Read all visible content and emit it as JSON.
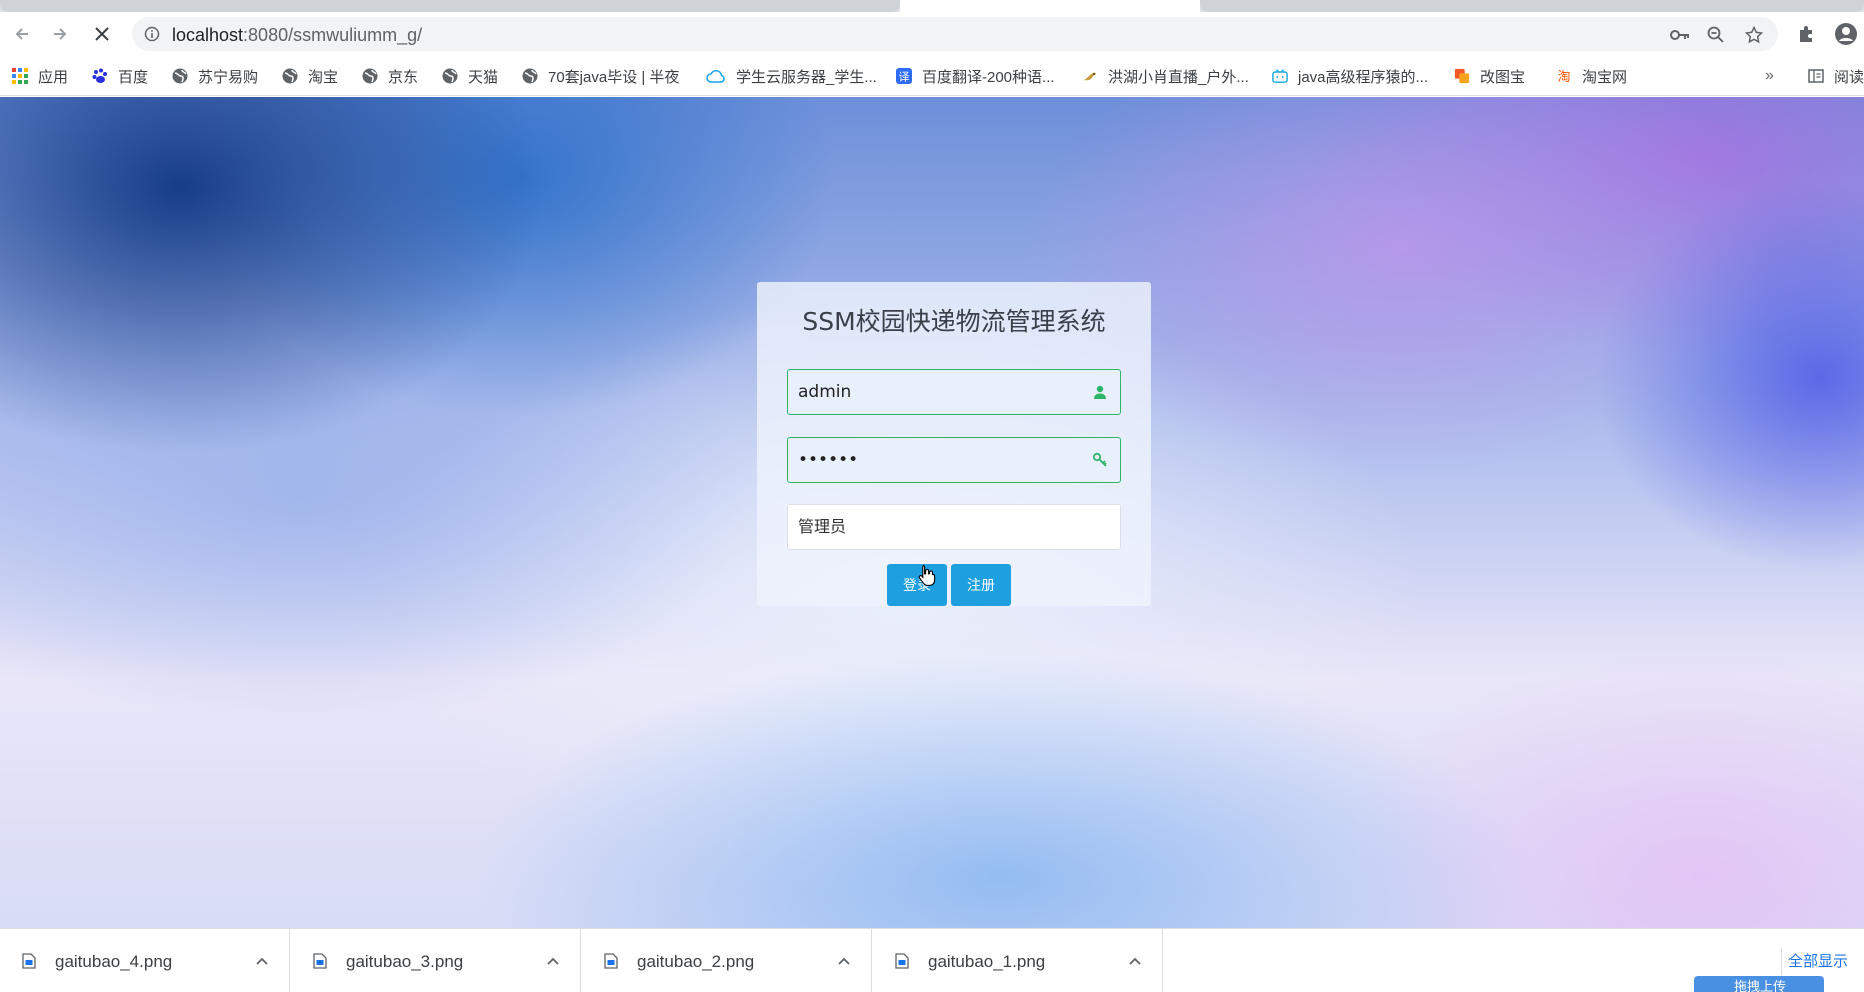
{
  "browser": {
    "url_host": "localhost",
    "url_path": ":8080/ssmwuliumm_g/",
    "bookmarks": [
      {
        "label": "应用",
        "icon": "apps-grid-icon"
      },
      {
        "label": "百度",
        "icon": "baidu-paw-icon"
      },
      {
        "label": "苏宁易购",
        "icon": "globe-icon"
      },
      {
        "label": "淘宝",
        "icon": "globe-icon"
      },
      {
        "label": "京东",
        "icon": "globe-icon"
      },
      {
        "label": "天猫",
        "icon": "globe-icon"
      },
      {
        "label": "70套java毕设 | 半夜",
        "icon": "globe-icon"
      },
      {
        "label": "学生云服务器_学生...",
        "icon": "cloud-icon"
      },
      {
        "label": "百度翻译-200种语...",
        "icon": "translate-icon"
      },
      {
        "label": "洪湖小肖直播_户外...",
        "icon": "bird-icon"
      },
      {
        "label": "java高级程序猿的...",
        "icon": "bilibili-icon"
      },
      {
        "label": "改图宝",
        "icon": "gaitubao-icon"
      },
      {
        "label": "淘宝网",
        "icon": "taobao-icon"
      }
    ],
    "reading_list_label": "阅读"
  },
  "login": {
    "title": "SSM校园快递物流管理系统",
    "username_value": "admin",
    "password_value": "••••••",
    "role_selected": "管理员",
    "login_button": "登录",
    "register_button": "注册"
  },
  "downloads": {
    "items": [
      "gaitubao_4.png",
      "gaitubao_3.png",
      "gaitubao_2.png",
      "gaitubao_1.png"
    ],
    "show_all": "全部显示",
    "floating_label": "拖拽上传"
  },
  "colors": {
    "accent_green": "#2fb56a",
    "button_blue": "#1e9fe0"
  }
}
